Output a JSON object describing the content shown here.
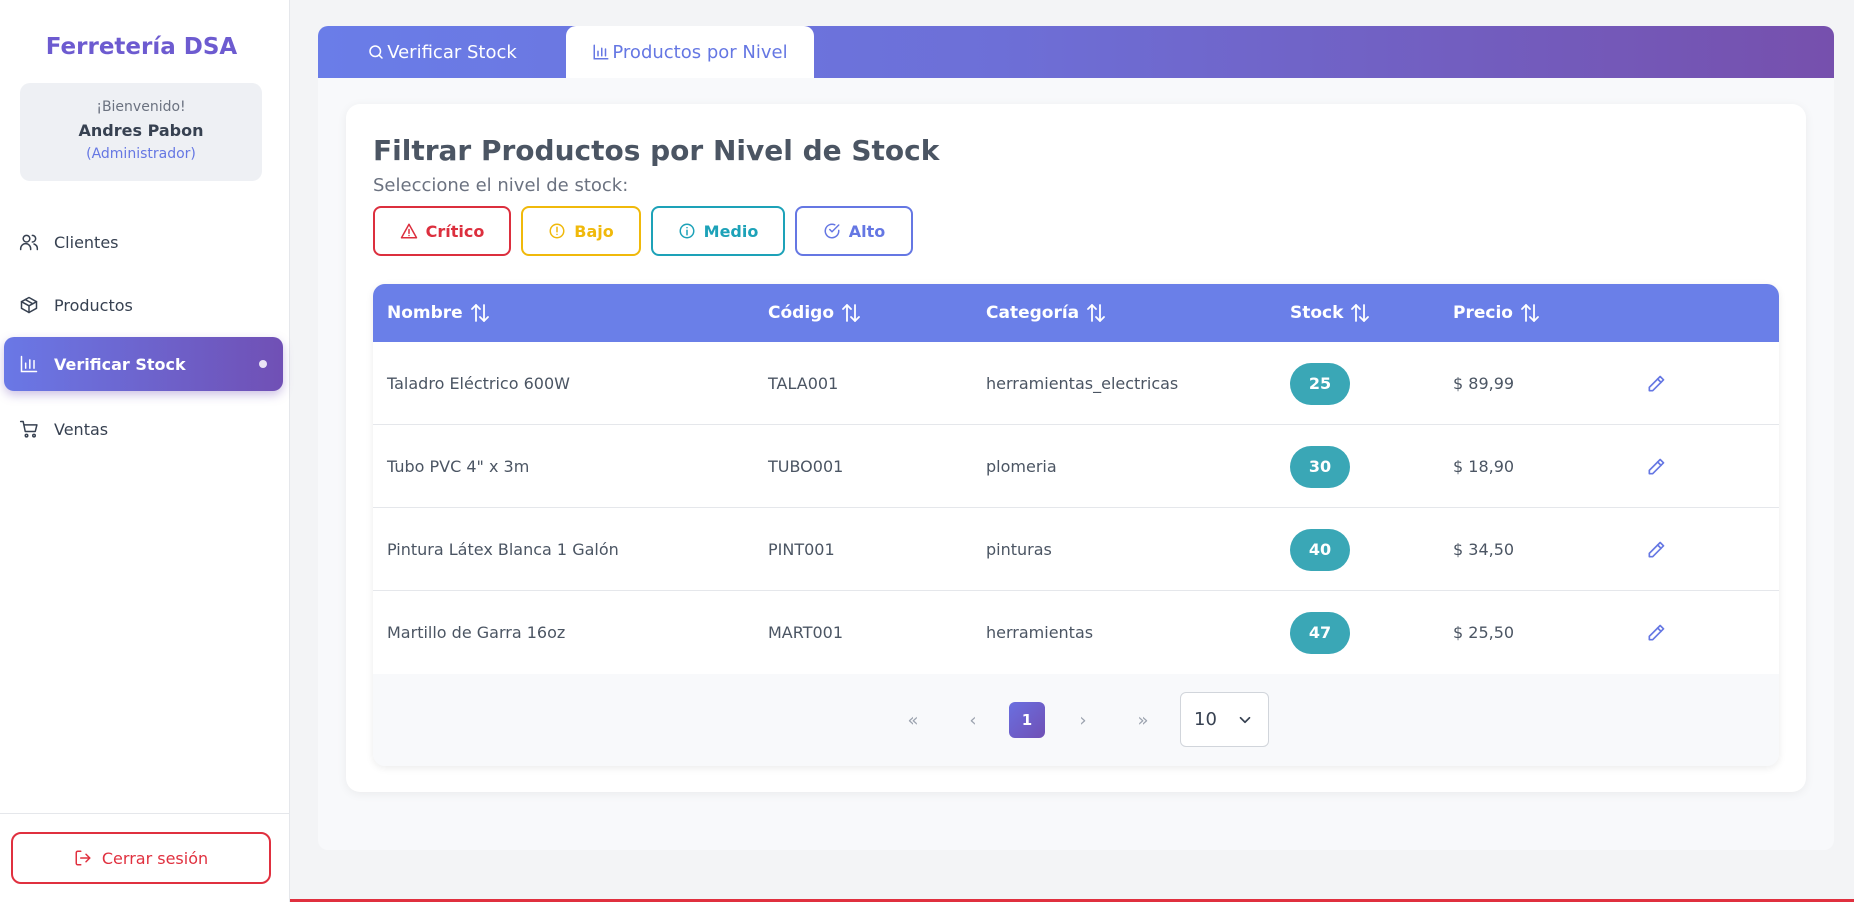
{
  "sidebar": {
    "brand": "Ferretería DSA",
    "welcome": {
      "greeting": "¡Bienvenido!",
      "name": "Andres Pabon",
      "role": "(Administrador)"
    },
    "items": [
      {
        "label": "Clientes",
        "icon": "users-icon"
      },
      {
        "label": "Productos",
        "icon": "box-icon"
      },
      {
        "label": "Verificar Stock",
        "icon": "bar-chart-icon",
        "active": true
      },
      {
        "label": "Ventas",
        "icon": "cart-icon"
      }
    ],
    "logout_label": "Cerrar sesión"
  },
  "tabs": [
    {
      "label": "Verificar Stock",
      "icon": "search-icon"
    },
    {
      "label": "Productos por Nivel",
      "icon": "bar-chart-icon",
      "active": true
    }
  ],
  "filter_card": {
    "title": "Filtrar Productos por Nivel de Stock",
    "subtitle": "Seleccione el nivel de stock:",
    "levels": [
      {
        "label": "Crítico",
        "icon": "warning-triangle-icon",
        "color": "#dc2f3e"
      },
      {
        "label": "Bajo",
        "icon": "alert-circle-icon",
        "color": "#f0b90b"
      },
      {
        "label": "Medio",
        "icon": "info-circle-icon",
        "color": "#1da2b8"
      },
      {
        "label": "Alto",
        "icon": "check-circle-icon",
        "color": "#6577e3"
      }
    ]
  },
  "table": {
    "columns": [
      "Nombre",
      "Código",
      "Categoría",
      "Stock",
      "Precio"
    ],
    "rows": [
      {
        "nombre": "Taladro Eléctrico 600W",
        "codigo": "TALA001",
        "categoria": "herramientas_electricas",
        "stock": "25",
        "precio": "$ 89,99"
      },
      {
        "nombre": "Tubo PVC 4\" x 3m",
        "codigo": "TUBO001",
        "categoria": "plomeria",
        "stock": "30",
        "precio": "$ 18,90"
      },
      {
        "nombre": "Pintura Látex Blanca 1 Galón",
        "codigo": "PINT001",
        "categoria": "pinturas",
        "stock": "40",
        "precio": "$ 34,50"
      },
      {
        "nombre": "Martillo de Garra 16oz",
        "codigo": "MART001",
        "categoria": "herramientas",
        "stock": "47",
        "precio": "$ 25,50"
      }
    ]
  },
  "pagination": {
    "current_page": "1",
    "first": "«",
    "prev": "‹",
    "next": "›",
    "last": "»",
    "per_page": "10"
  },
  "colors": {
    "accent": "#6577e3",
    "accent_dark": "#7050b5",
    "danger": "#e0303f",
    "stock_badge": "#3aa7b6"
  }
}
